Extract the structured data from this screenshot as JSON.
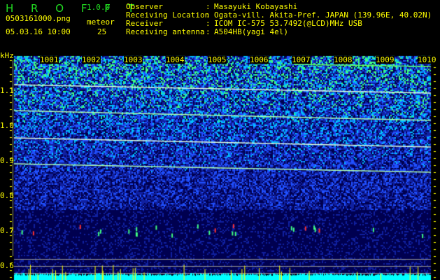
{
  "header": {
    "logo": "H R O F F T",
    "version": "1.0.0",
    "filename": "0503161000.png",
    "datetime": "05.03.16 10:00",
    "meteor_label": "meteor",
    "meteor_count": "25"
  },
  "info": [
    {
      "label": "Observer",
      "value": "Masayuki Kobayashi"
    },
    {
      "label": "Receiving Location",
      "value": "Ogata-vill. Akita-Pref. JAPAN (139.96E, 40.02N)"
    },
    {
      "label": "Receiver",
      "value": "ICOM IC-575 53.7492(@LCD)MHz USB"
    },
    {
      "label": "Receiving antenna",
      "value": "A504HB(yagi 4el)"
    }
  ],
  "spectrogram": {
    "y_unit": "kHz",
    "y_ticks": [
      "1.1",
      "1.0",
      "0.9",
      "0.8",
      "0.7",
      "0.6"
    ],
    "time_ticks": [
      "1001",
      "1002",
      "1003",
      "1004",
      "1005",
      "1006",
      "1007",
      "1008",
      "1009",
      "1010"
    ],
    "colors": {
      "label": "#ffff00",
      "noise_floor": "#00ffff",
      "logo": "#22dd22"
    }
  }
}
